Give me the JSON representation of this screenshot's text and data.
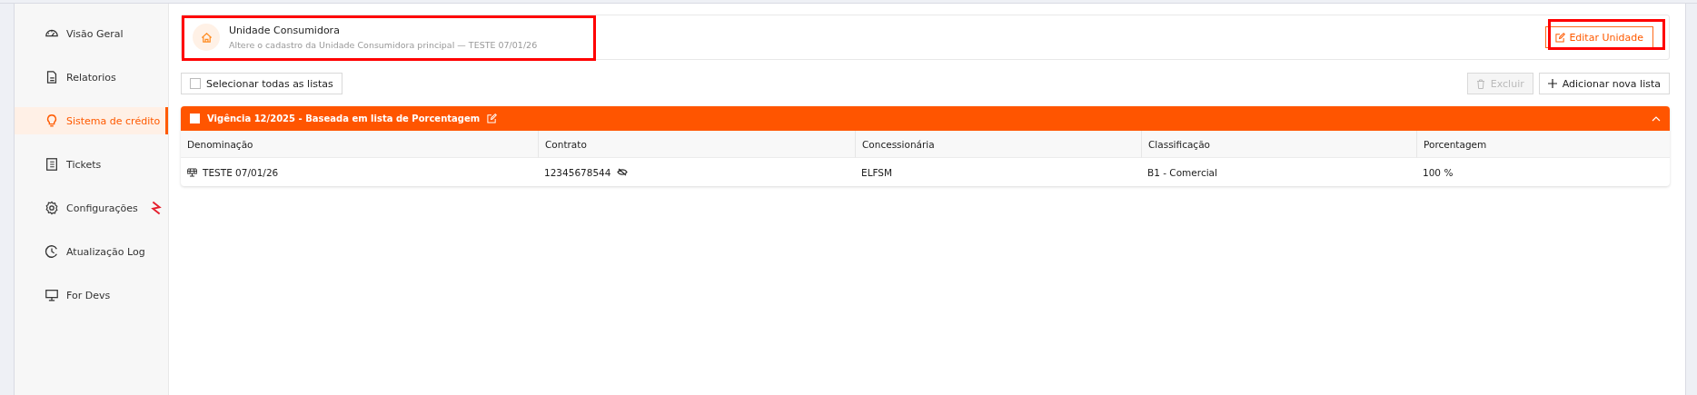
{
  "sidebar": {
    "items": [
      {
        "label": "Visão Geral",
        "selected": false,
        "flag": false
      },
      {
        "label": "Relatorios",
        "selected": false,
        "flag": false
      },
      {
        "label": "Sistema de crédito",
        "selected": true,
        "flag": false
      },
      {
        "label": "Tickets",
        "selected": false,
        "flag": false
      },
      {
        "label": "Configurações",
        "selected": false,
        "flag": true
      },
      {
        "label": "Atualização Log",
        "selected": false,
        "flag": false
      },
      {
        "label": "For Devs",
        "selected": false,
        "flag": false
      }
    ]
  },
  "unit_card": {
    "title": "Unidade Consumidora",
    "subtitle": "Altere o cadastro da Unidade Consumidora principal — TESTE 07/01/26",
    "edit_button": "Editar Unidade"
  },
  "toolbar": {
    "select_all": {
      "label": "Selecionar todas as listas",
      "checked": false
    },
    "delete_button": {
      "label": "Excluir",
      "disabled": true
    },
    "add_button": "Adicionar nova lista"
  },
  "lists": [
    {
      "title": "Vigência 12/2025 - Baseada em lista de Porcentagem",
      "checked": false,
      "expanded": true,
      "columns": [
        "Denominação",
        "Contrato",
        "Concessionária",
        "Classificação",
        "Porcentagem"
      ],
      "rows": [
        [
          "TESTE 07/01/26",
          "12345678544",
          "ELFSM",
          "B1 - Comercial",
          "100 %"
        ]
      ]
    }
  ]
}
